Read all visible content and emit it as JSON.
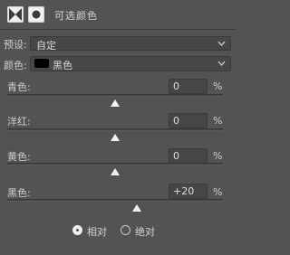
{
  "header": {
    "title": "可选颜色",
    "icons": [
      "adjustment-layer-icon",
      "layer-mask-icon"
    ]
  },
  "preset": {
    "label": "预设:",
    "value": "自定"
  },
  "colors": {
    "label": "颜色:",
    "value": "黑色",
    "swatch_color": "#000000"
  },
  "sliders": [
    {
      "label": "青色:",
      "value": "0",
      "unit": "%",
      "level": 0.5
    },
    {
      "label": "洋红:",
      "value": "0",
      "unit": "%",
      "level": 0.5
    },
    {
      "label": "黄色:",
      "value": "0",
      "unit": "%",
      "level": 0.5
    },
    {
      "label": "黑色:",
      "value": "+20",
      "unit": "%",
      "level": 0.6
    }
  ],
  "mode": {
    "options": [
      {
        "label": "相对",
        "selected": true
      },
      {
        "label": "绝对",
        "selected": false
      }
    ]
  }
}
